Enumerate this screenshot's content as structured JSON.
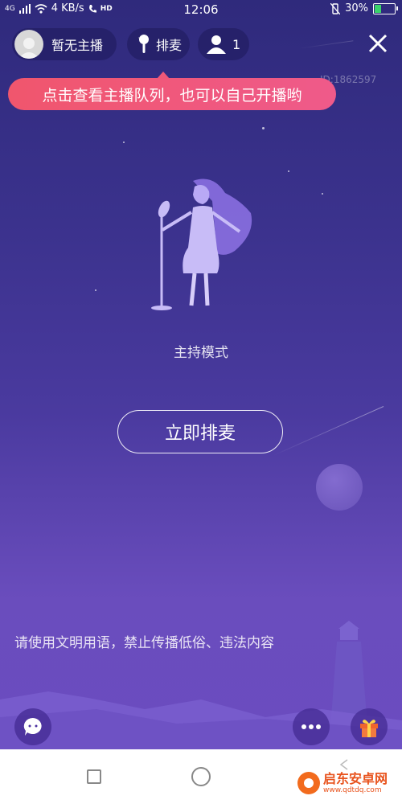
{
  "status_bar": {
    "network_type": "4G",
    "speed": "4 KB/s",
    "hd_badge": "HD",
    "time": "12:06",
    "battery": "30%",
    "battery_level": 0.3
  },
  "top_bar": {
    "host_label": "暂无主播",
    "queue_label": "排麦",
    "audience_count": "1",
    "room_id": "ID:1862597"
  },
  "tooltip": {
    "text": "点击查看主播队列，也可以自己开播哟"
  },
  "main": {
    "mode_label": "主持模式",
    "apply_button": "立即排麦"
  },
  "notice": {
    "text": "请使用文明用语，禁止传播低俗、违法内容"
  },
  "bottom_bar": {
    "chat_icon": "chat-bubble-icon",
    "more_icon": "more-dots-icon",
    "gift_icon": "gift-icon"
  },
  "watermark": {
    "title": "启东安卓网",
    "url": "www.qdtdq.com"
  },
  "colors": {
    "background_top": "#2f2a7c",
    "background_bottom": "#6b4cc0",
    "tooltip": "#f0566d",
    "gift": "#f0642d"
  }
}
